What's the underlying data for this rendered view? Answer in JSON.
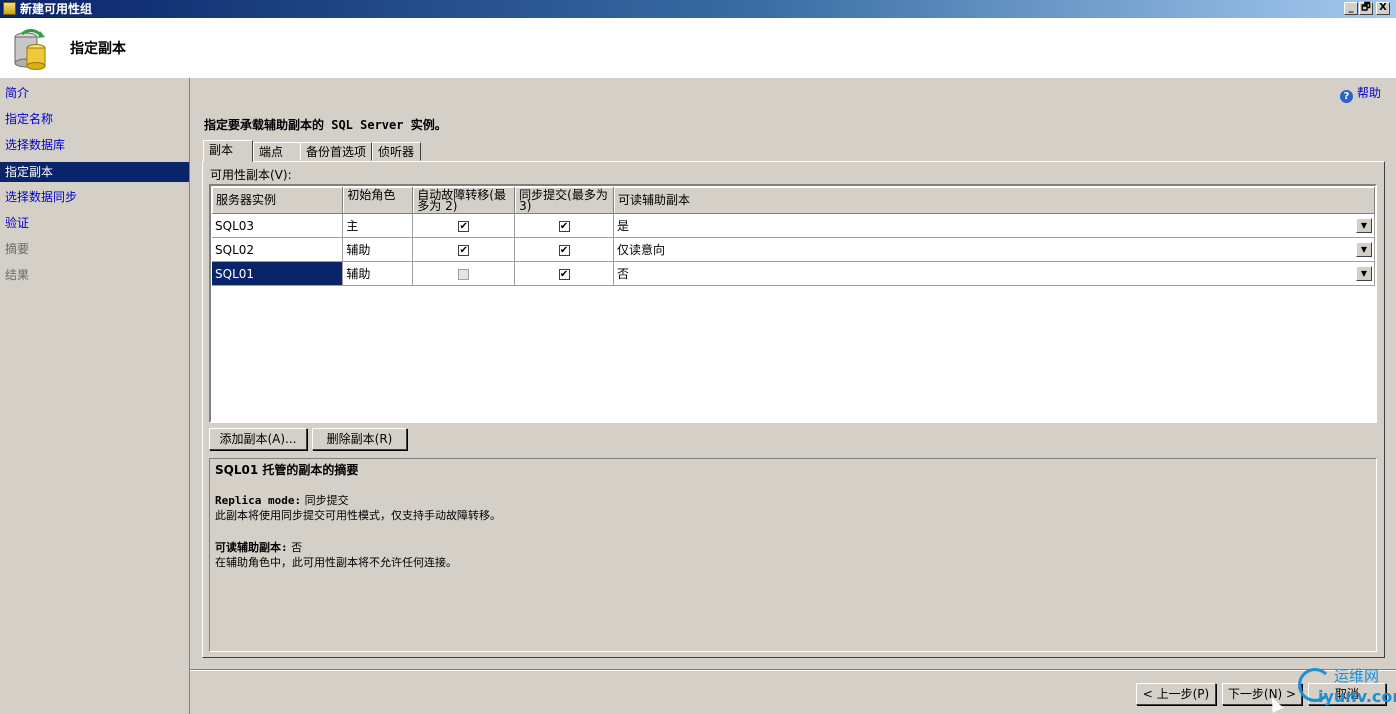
{
  "window": {
    "title": "新建可用性组",
    "min_label": "_",
    "restore_label": "🗗",
    "close_label": "X"
  },
  "header": {
    "title": "指定副本"
  },
  "sidebar": {
    "items": [
      {
        "label": "简介",
        "state": "link"
      },
      {
        "label": "指定名称",
        "state": "link"
      },
      {
        "label": "选择数据库",
        "state": "link"
      },
      {
        "label": "指定副本",
        "state": "active"
      },
      {
        "label": "选择数据同步",
        "state": "link"
      },
      {
        "label": "验证",
        "state": "link"
      },
      {
        "label": "摘要",
        "state": "disabled"
      },
      {
        "label": "结果",
        "state": "disabled"
      }
    ]
  },
  "help": {
    "label": "帮助",
    "icon": "help-icon"
  },
  "instruction": "指定要承载辅助副本的 SQL Server 实例。",
  "tabs": [
    {
      "label": "副本",
      "active": true
    },
    {
      "label": "端点",
      "active": false
    },
    {
      "label": "备份首选项",
      "active": false
    },
    {
      "label": "侦听器",
      "active": false
    }
  ],
  "grid": {
    "label": "可用性副本(V):",
    "columns": [
      "服务器实例",
      "初始角色",
      "自动故障转移(最多为 2)",
      "同步提交(最多为 3)",
      "可读辅助副本"
    ],
    "rows": [
      {
        "server": "SQL03",
        "role": "主",
        "auto_failover": true,
        "auto_failover_enabled": true,
        "sync_commit": true,
        "readable": "是",
        "selected": false
      },
      {
        "server": "SQL02",
        "role": "辅助",
        "auto_failover": true,
        "auto_failover_enabled": true,
        "sync_commit": true,
        "readable": "仅读意向",
        "selected": false
      },
      {
        "server": "SQL01",
        "role": "辅助",
        "auto_failover": false,
        "auto_failover_enabled": false,
        "sync_commit": true,
        "readable": "否",
        "selected": true
      }
    ]
  },
  "buttons": {
    "add_replica": "添加副本(A)...",
    "remove_replica": "删除副本(R)"
  },
  "summary": {
    "title": "SQL01 托管的副本的摘要",
    "mode_key": "Replica mode:",
    "mode_value": "同步提交",
    "mode_desc": "此副本将使用同步提交可用性模式，仅支持手动故障转移。",
    "readable_key": "可读辅助副本:",
    "readable_value": "否",
    "readable_desc": "在辅助角色中，此可用性副本将不允许任何连接。"
  },
  "footer": {
    "prev": "< 上一步(P)",
    "next": "下一步(N) >",
    "cancel": "取消"
  },
  "watermark": {
    "line1": "运维网",
    "line2": "iyunv.com"
  }
}
